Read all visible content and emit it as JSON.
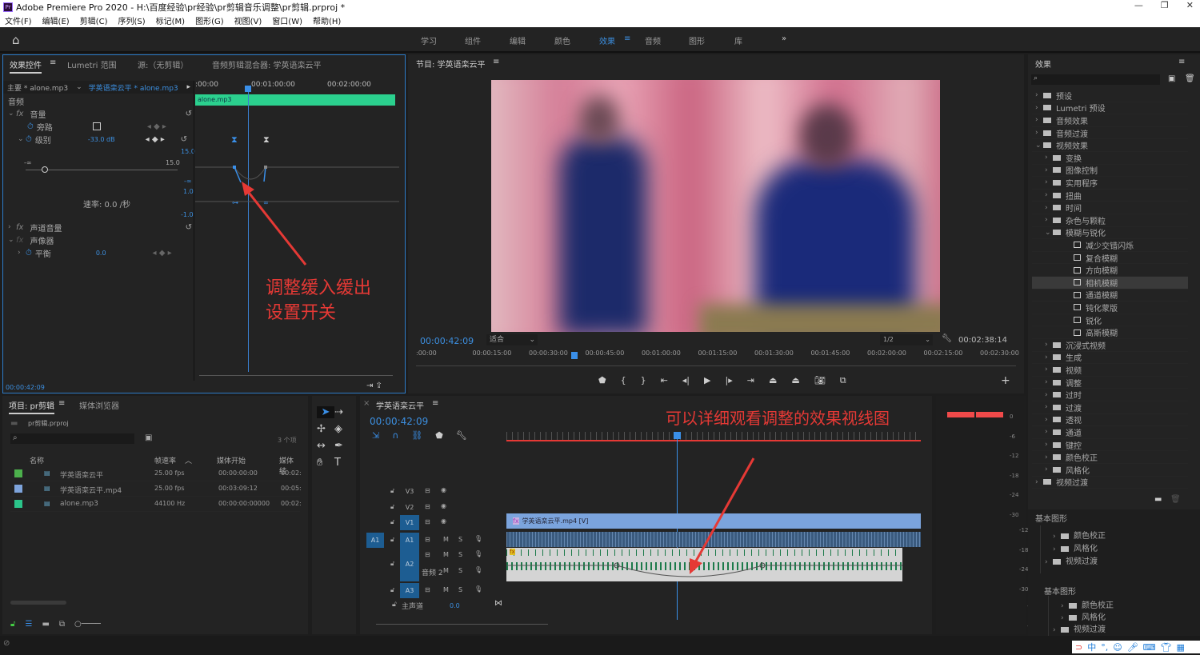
{
  "app": {
    "title": "Adobe Premiere Pro 2020 - H:\\百度经验\\pr经验\\pr剪辑音乐调整\\pr剪辑.prproj *",
    "logo": "Pr"
  },
  "menu": [
    "文件(F)",
    "编辑(E)",
    "剪辑(C)",
    "序列(S)",
    "标记(M)",
    "图形(G)",
    "视图(V)",
    "窗口(W)",
    "帮助(H)"
  ],
  "workspaces": {
    "items": [
      "学习",
      "组件",
      "编辑",
      "颜色",
      "效果",
      "音频",
      "图形",
      "库"
    ],
    "active": "效果",
    "more": "»"
  },
  "effect_controls": {
    "tabs": [
      "效果控件",
      "Lumetri 范围",
      "源:（无剪辑）",
      "音频剪辑混合器: 学英语栾云平"
    ],
    "master": "主要 * alone.mp3",
    "clip": "学英语栾云平 * alone.mp3",
    "ruler": [
      ":00:00",
      "00:01:00:00",
      "00:02:00:00"
    ],
    "clip_bar": "alone.mp3",
    "section": "音频",
    "volume": "音量",
    "bypass": "旁路",
    "level": "级别",
    "level_value": "-33.0 dB",
    "slider_min": "-∞",
    "slider_max": "15.0",
    "graph_labels": [
      "15.0",
      "-∞",
      "1.0",
      "-1.0"
    ],
    "velocity": "速率: 0.0 /秒",
    "channel_volume": "声道音量",
    "panner": "声像器",
    "balance": "平衡",
    "balance_value": "0.0",
    "timecode": "00:00:42:09"
  },
  "annotation1": {
    "line1": "调整缓入缓出",
    "line2": "设置开关",
    "color": "#e53935"
  },
  "annotation2": {
    "text": "可以详细观看调整的效果视线图",
    "color": "#e53935"
  },
  "program": {
    "title": "节目: 学英语栾云平",
    "timecode": "00:00:42:09",
    "fit": "适合",
    "resolution": "1/2",
    "duration": "00:02:38:14",
    "ruler": [
      ":00:00",
      "00:00:15:00",
      "00:00:30:00",
      "00:00:45:00",
      "00:01:00:00",
      "00:01:15:00",
      "00:01:30:00",
      "00:01:45:00",
      "00:02:00:00",
      "00:02:15:00",
      "00:02:30:00"
    ]
  },
  "effects_panel": {
    "title": "效果",
    "items": [
      {
        "label": "预设",
        "level": 0,
        "type": "preset"
      },
      {
        "label": "Lumetri 预设",
        "level": 0,
        "type": "preset"
      },
      {
        "label": "音频效果",
        "level": 0,
        "type": "folder"
      },
      {
        "label": "音频过渡",
        "level": 0,
        "type": "folder"
      },
      {
        "label": "视频效果",
        "level": 0,
        "type": "folder",
        "open": true
      },
      {
        "label": "变换",
        "level": 1,
        "type": "folder"
      },
      {
        "label": "图像控制",
        "level": 1,
        "type": "folder"
      },
      {
        "label": "实用程序",
        "level": 1,
        "type": "folder"
      },
      {
        "label": "扭曲",
        "level": 1,
        "type": "folder"
      },
      {
        "label": "时间",
        "level": 1,
        "type": "folder"
      },
      {
        "label": "杂色与颗粒",
        "level": 1,
        "type": "folder"
      },
      {
        "label": "模糊与锐化",
        "level": 1,
        "type": "folder",
        "open": true
      },
      {
        "label": "减少交错闪烁",
        "level": 2,
        "type": "effect"
      },
      {
        "label": "复合模糊",
        "level": 2,
        "type": "effect"
      },
      {
        "label": "方向模糊",
        "level": 2,
        "type": "effect"
      },
      {
        "label": "相机模糊",
        "level": 2,
        "type": "effect",
        "selected": true
      },
      {
        "label": "通道模糊",
        "level": 2,
        "type": "effect"
      },
      {
        "label": "钝化蒙版",
        "level": 2,
        "type": "effect"
      },
      {
        "label": "锐化",
        "level": 2,
        "type": "effect"
      },
      {
        "label": "高斯模糊",
        "level": 2,
        "type": "effect"
      },
      {
        "label": "沉浸式视频",
        "level": 1,
        "type": "folder"
      },
      {
        "label": "生成",
        "level": 1,
        "type": "folder"
      },
      {
        "label": "视频",
        "level": 1,
        "type": "folder"
      },
      {
        "label": "调整",
        "level": 1,
        "type": "folder"
      },
      {
        "label": "过时",
        "level": 1,
        "type": "folder"
      },
      {
        "label": "过渡",
        "level": 1,
        "type": "folder"
      },
      {
        "label": "透视",
        "level": 1,
        "type": "folder"
      },
      {
        "label": "通道",
        "level": 1,
        "type": "folder"
      },
      {
        "label": "键控",
        "level": 1,
        "type": "folder"
      },
      {
        "label": "颜色校正",
        "level": 1,
        "type": "folder"
      },
      {
        "label": "风格化",
        "level": 1,
        "type": "folder"
      },
      {
        "label": "视频过渡",
        "level": 0,
        "type": "folder"
      }
    ],
    "essential1": "基本图形",
    "ghost1": [
      "颜色校正",
      "风格化",
      "视频过渡"
    ],
    "essential2": "基本图形",
    "ghost2": [
      "颜色校正",
      "风格化",
      "视频过渡"
    ]
  },
  "project": {
    "tabs": [
      "项目: pr剪辑",
      "媒体浏览器"
    ],
    "file": "pr剪辑.prproj",
    "count": "3 个项",
    "columns": [
      "名称",
      "帧速率",
      "媒体开始",
      "媒体结"
    ],
    "rows": [
      {
        "color": "#4cb04c",
        "name": "学英语栾云平",
        "rate": "25.00 fps",
        "start": "00:00:00:00",
        "end": "00:02:"
      },
      {
        "color": "#7ea4dc",
        "name": "学英语栾云平.mp4",
        "rate": "25.00 fps",
        "start": "00:03:09:12",
        "end": "00:05:"
      },
      {
        "color": "#2bc48a",
        "name": "alone.mp3",
        "rate": "44100 Hz",
        "start": "00:00:00:00000",
        "end": "00:02:"
      }
    ]
  },
  "timeline": {
    "title": "学英语栾云平",
    "timecode": "00:00:42:09",
    "tracks": [
      {
        "id": "V3"
      },
      {
        "id": "V2"
      },
      {
        "id": "V1"
      },
      {
        "id": "A1",
        "src": "A1"
      },
      {
        "id": "A2",
        "name": "音频 2"
      },
      {
        "id": "A3"
      }
    ],
    "master": "主声道",
    "master_value": "0.0",
    "video_clip": "学英语栾云平.mp4 [V]",
    "mute": "M",
    "solo": "S"
  },
  "meter": {
    "ticks": [
      "0",
      "-6",
      "-12",
      "-18",
      "-24",
      "-30"
    ],
    "ticks2": [
      "-12",
      "-18",
      "-24",
      "-30"
    ],
    "ticks3": [
      "-12",
      "-18"
    ]
  }
}
